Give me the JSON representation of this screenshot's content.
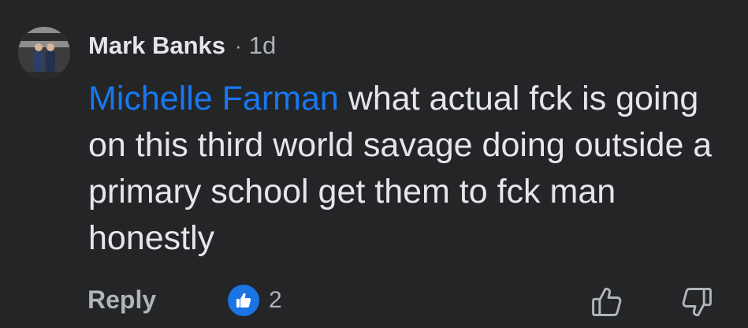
{
  "comment": {
    "author": "Mark Banks",
    "separator": "·",
    "time": "1d",
    "mention": "Michelle Farman",
    "text": " what actual fck is going on this third world savage doing outside a primary school get them to fck man honestly"
  },
  "actions": {
    "reply_label": "Reply",
    "reaction_icon": "like-icon",
    "reaction_count": "2",
    "upvote_icon": "thumbs-up-outline-icon",
    "downvote_icon": "thumbs-down-outline-icon"
  },
  "colors": {
    "background": "#242526",
    "mention": "#1877f2",
    "like": "#1b74e4"
  }
}
